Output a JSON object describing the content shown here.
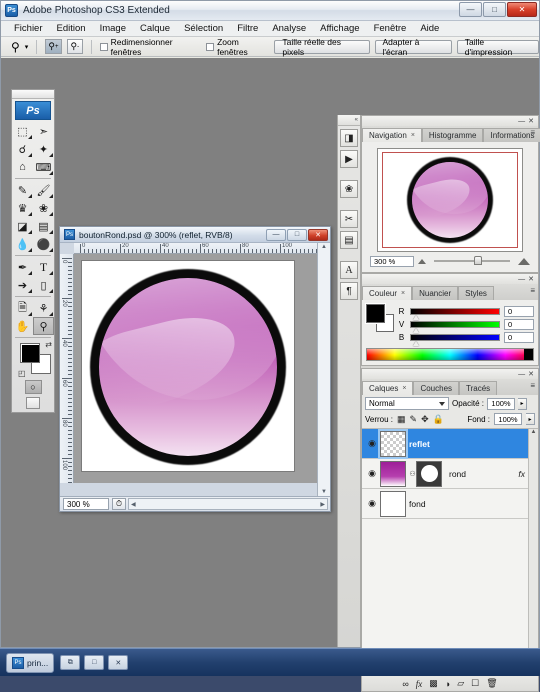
{
  "window": {
    "title": "Adobe Photoshop CS3 Extended",
    "app_icon": "photoshop-icon",
    "minimize": "—",
    "maximize": "□",
    "close": "✕"
  },
  "menubar": {
    "items": [
      "Fichier",
      "Edition",
      "Image",
      "Calque",
      "Sélection",
      "Filtre",
      "Analyse",
      "Affichage",
      "Fenêtre",
      "Aide"
    ]
  },
  "options_bar": {
    "tool_icon": "zoom-tool-icon",
    "tool_caret": "▾",
    "zoom_in_icon": "zoom-in-icon",
    "zoom_out_icon": "zoom-out-icon",
    "resize_windows_label": "Redimensionner fenêtres",
    "zoom_windows_label": "Zoom fenêtres",
    "actual_pixels_label": "Taille réelle des pixels",
    "fit_screen_label": "Adapter à l'écran",
    "print_size_label": "Taille d'impression"
  },
  "toolbox": {
    "logo": "Ps",
    "tools": [
      {
        "name": "marquee-tool",
        "glyph": "⬚"
      },
      {
        "name": "move-tool",
        "glyph": "✣"
      },
      {
        "name": "lasso-tool",
        "glyph": "☈"
      },
      {
        "name": "magic-wand-tool",
        "glyph": "✦"
      },
      {
        "name": "crop-tool",
        "glyph": "⌘"
      },
      {
        "name": "slice-tool",
        "glyph": "✂"
      },
      {
        "name": "healing-brush-tool",
        "glyph": "✐"
      },
      {
        "name": "brush-tool",
        "glyph": "✎"
      },
      {
        "name": "clone-stamp-tool",
        "glyph": "♟"
      },
      {
        "name": "history-brush-tool",
        "glyph": "❀"
      },
      {
        "name": "eraser-tool",
        "glyph": "◥"
      },
      {
        "name": "gradient-tool",
        "glyph": "▤"
      },
      {
        "name": "blur-tool",
        "glyph": "●"
      },
      {
        "name": "dodge-tool",
        "glyph": "⚲"
      },
      {
        "name": "pen-tool",
        "glyph": "✒"
      },
      {
        "name": "type-tool",
        "glyph": "T"
      },
      {
        "name": "path-selection-tool",
        "glyph": "➤"
      },
      {
        "name": "shape-tool",
        "glyph": "■"
      },
      {
        "name": "notes-tool",
        "glyph": "✐"
      },
      {
        "name": "eyedropper-tool",
        "glyph": "⚗"
      },
      {
        "name": "hand-tool",
        "glyph": "✋"
      },
      {
        "name": "zoom-tool",
        "glyph": "⌕"
      }
    ],
    "foreground_color": "#000000",
    "background_color": "#ffffff",
    "swap_icon": "⇄",
    "default_icon": "◰",
    "quick_mask_standard": "□",
    "quick_mask_edit": "○",
    "screen_modes": [
      "standard-screen-mode",
      "full-screen-menubar-mode",
      "full-screen-mode"
    ]
  },
  "document": {
    "icon": "psd-file-icon",
    "title": "boutonRond.psd @ 300% (reflet, RVB/8)",
    "minimize": "—",
    "maximize": "□",
    "close": "✕",
    "zoom_level": "300 %",
    "ruler_marks": [
      "0",
      "20",
      "40",
      "60",
      "80",
      "100"
    ],
    "ruler_unit": "pixels"
  },
  "dock_strip": {
    "collapse_icon": "«",
    "buttons": [
      {
        "name": "bridge-icon",
        "glyph": "◨"
      },
      {
        "name": "animation-icon",
        "glyph": "▶"
      },
      {
        "name": "brushes-icon",
        "glyph": "ℒ"
      },
      {
        "name": "tool-presets-icon",
        "glyph": "✂"
      },
      {
        "name": "layer-comps-icon",
        "glyph": "▤"
      },
      {
        "name": "character-icon",
        "glyph": "A"
      },
      {
        "name": "paragraph-icon",
        "glyph": "¶"
      }
    ]
  },
  "navigator_panel": {
    "tabs": [
      {
        "label": "Navigation",
        "close": "×",
        "active": true
      },
      {
        "label": "Histogramme",
        "active": false
      },
      {
        "label": "Informations",
        "active": false
      }
    ],
    "menu_icon": "≡",
    "minimize_icon": "—",
    "close_icon": "✕",
    "zoom_value": "300 %",
    "zoom_out_icon": "zoom-out-triangle",
    "zoom_in_icon": "zoom-in-triangle",
    "view_box_color": "#c0514f"
  },
  "color_panel": {
    "tabs": [
      {
        "label": "Couleur",
        "close": "×",
        "active": true
      },
      {
        "label": "Nuancier",
        "active": false
      },
      {
        "label": "Styles",
        "active": false
      }
    ],
    "menu_icon": "≡",
    "minimize_icon": "—",
    "close_icon": "✕",
    "channels": [
      {
        "label": "R",
        "value": "0",
        "color": "#ff0000"
      },
      {
        "label": "V",
        "value": "0",
        "color": "#00ff00"
      },
      {
        "label": "B",
        "value": "0",
        "color": "#0000ff"
      }
    ],
    "foreground": "#000000",
    "background": "#ffffff"
  },
  "layers_panel": {
    "tabs": [
      {
        "label": "Calques",
        "close": "×",
        "active": true
      },
      {
        "label": "Couches",
        "active": false
      },
      {
        "label": "Tracés",
        "active": false
      }
    ],
    "menu_icon": "≡",
    "minimize_icon": "—",
    "close_icon": "✕",
    "blend_mode": "Normal",
    "opacity_label": "Opacité :",
    "opacity_value": "100%",
    "lock_label": "Verrou :",
    "lock_icons": [
      {
        "name": "lock-transparent-pixels-icon",
        "glyph": "▨"
      },
      {
        "name": "lock-image-pixels-icon",
        "glyph": "✐"
      },
      {
        "name": "lock-position-icon",
        "glyph": "✥"
      },
      {
        "name": "lock-all-icon",
        "glyph": "ὑ2"
      }
    ],
    "fill_label": "Fond :",
    "fill_value": "100%",
    "stepper_glyph": "▸",
    "layers": [
      {
        "name": "reflet",
        "visible": true,
        "selected": true,
        "thumb": "transparent",
        "has_mask": false,
        "has_fx": false
      },
      {
        "name": "rond",
        "visible": true,
        "selected": false,
        "thumb": "magenta",
        "has_mask": true,
        "has_fx": true,
        "fx_label": "fx"
      },
      {
        "name": "fond",
        "visible": true,
        "selected": false,
        "thumb": "white",
        "has_mask": false,
        "has_fx": false
      }
    ],
    "eye_glyph": "◉",
    "link_glyph": "⧉",
    "footer_buttons": [
      {
        "name": "link-layers-icon",
        "glyph": "∞"
      },
      {
        "name": "layer-style-icon",
        "glyph": "fx"
      },
      {
        "name": "add-layer-mask-icon",
        "glyph": "□"
      },
      {
        "name": "adjustment-layer-icon",
        "glyph": "◑"
      },
      {
        "name": "new-group-icon",
        "glyph": "▱"
      },
      {
        "name": "new-layer-icon",
        "glyph": "❐"
      },
      {
        "name": "delete-layer-icon",
        "glyph": "♻"
      }
    ]
  },
  "taskbar": {
    "item_label": "prin...",
    "item_icon": "photoshop-icon",
    "buttons": [
      {
        "name": "taskbar-restore-button",
        "glyph": "⧉"
      },
      {
        "name": "taskbar-minimize-button",
        "glyph": "□"
      },
      {
        "name": "taskbar-close-button",
        "glyph": "✕"
      }
    ]
  },
  "artwork": {
    "description": "round glossy magenta button with black ring and S-curved highlight",
    "ring_color": "#0b0b0b",
    "magenta_top": "#a3219e",
    "magenta_bottom": "#f4e2f1"
  }
}
